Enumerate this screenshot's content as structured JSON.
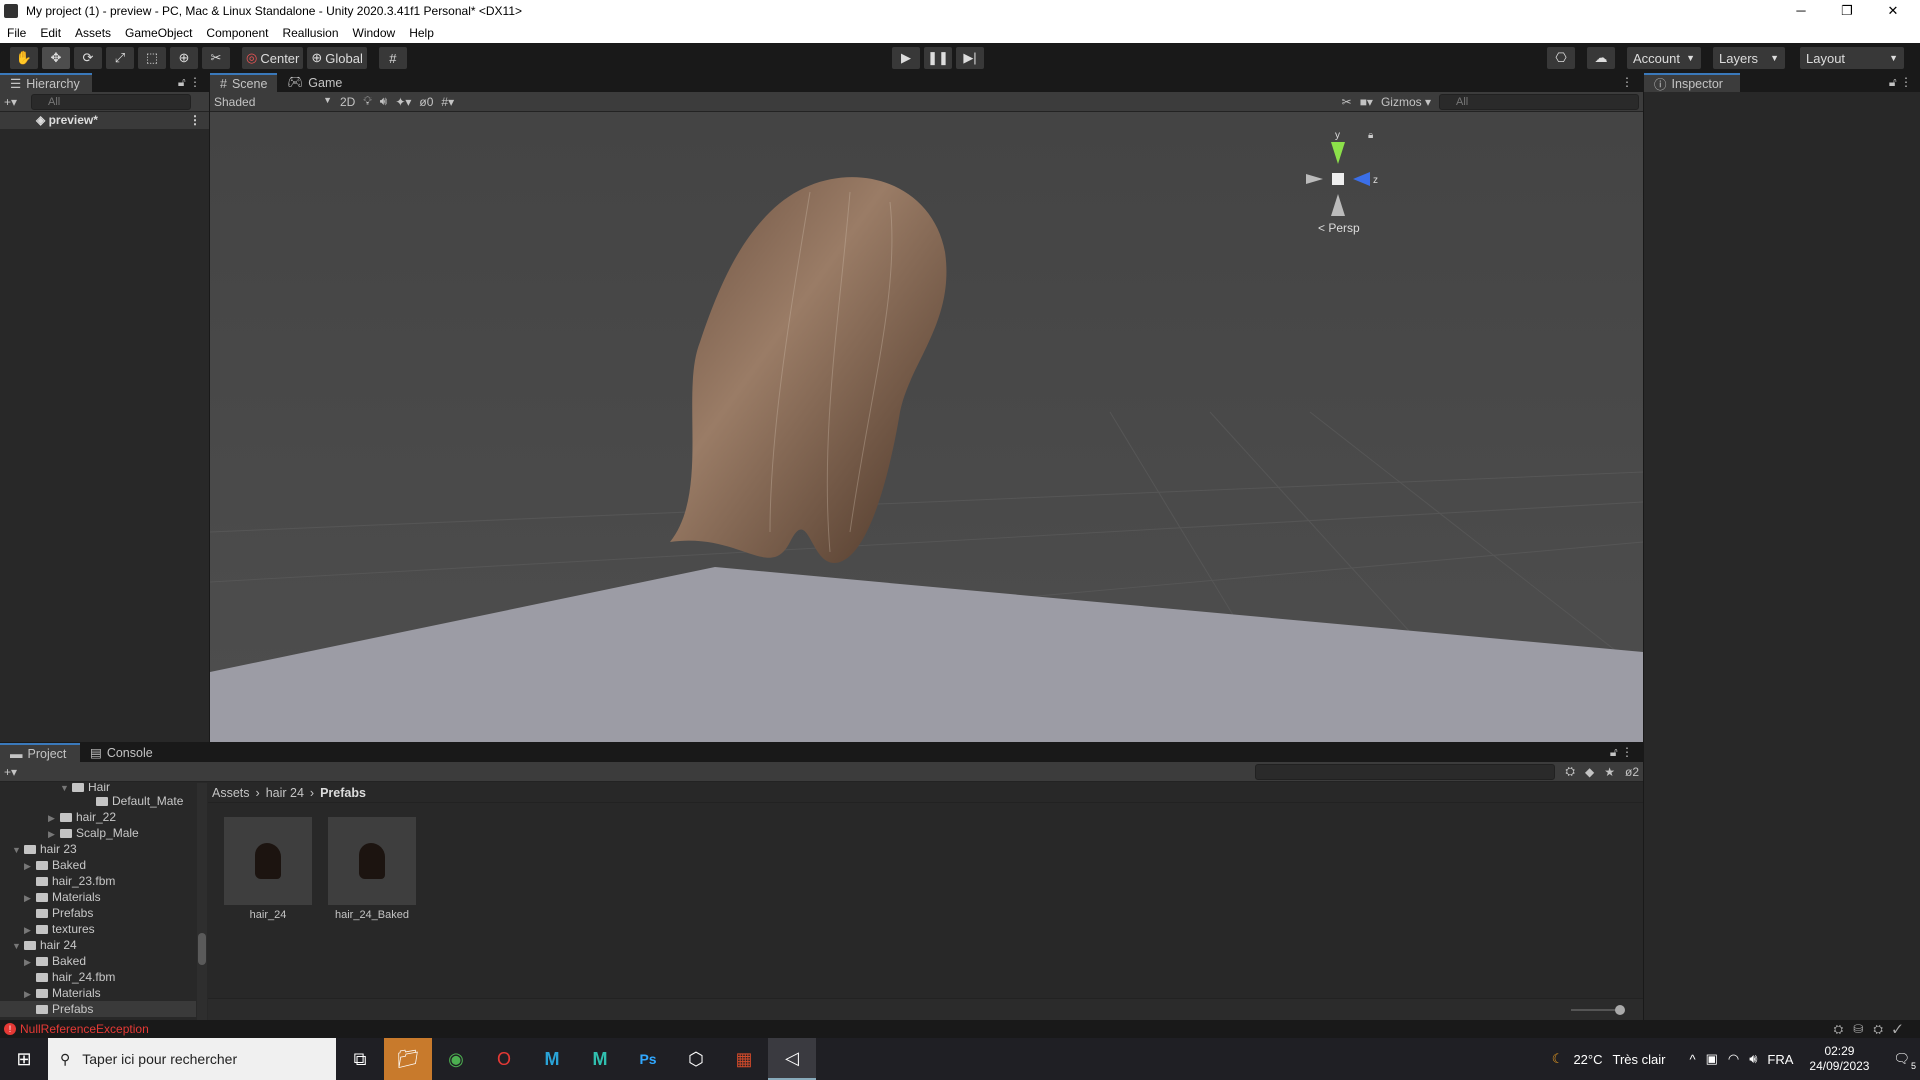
{
  "window": {
    "title": "My project (1) - preview - PC, Mac & Linux Standalone - Unity 2020.3.41f1 Personal* <DX11>",
    "min": "─",
    "max": "❐",
    "close": "✕"
  },
  "menu": [
    "File",
    "Edit",
    "Assets",
    "GameObject",
    "Component",
    "Reallusion",
    "Window",
    "Help"
  ],
  "toolbar": {
    "center": "Center",
    "global": "Global",
    "account": "Account",
    "layers": "Layers",
    "layout": "Layout"
  },
  "hierarchy": {
    "title": "Hierarchy",
    "search": "All",
    "scene": "preview*"
  },
  "scene": {
    "tab_scene": "Scene",
    "tab_game": "Game",
    "shading": "Shaded",
    "mode2d": "2D",
    "hidden_count": "0",
    "gizmos": "Gizmos",
    "search": "All",
    "persp": "Persp",
    "axis_y": "y",
    "axis_z": "z"
  },
  "inspector": {
    "title": "Inspector"
  },
  "project": {
    "tab_project": "Project",
    "tab_console": "Console",
    "hidden_count": "2",
    "breadcrumb": [
      "Assets",
      "hair 24",
      "Prefabs"
    ],
    "tree": [
      {
        "label": "Hair",
        "indent": 5,
        "arrow": "▼",
        "open": true
      },
      {
        "label": "Default_Mate",
        "indent": 7,
        "arrow": ""
      },
      {
        "label": "hair_22",
        "indent": 4,
        "arrow": "▶"
      },
      {
        "label": "Scalp_Male",
        "indent": 4,
        "arrow": "▶"
      },
      {
        "label": "hair 23",
        "indent": 1,
        "arrow": "▼",
        "open": true
      },
      {
        "label": "Baked",
        "indent": 2,
        "arrow": "▶"
      },
      {
        "label": "hair_23.fbm",
        "indent": 2,
        "arrow": ""
      },
      {
        "label": "Materials",
        "indent": 2,
        "arrow": "▶"
      },
      {
        "label": "Prefabs",
        "indent": 2,
        "arrow": ""
      },
      {
        "label": "textures",
        "indent": 2,
        "arrow": "▶"
      },
      {
        "label": "hair 24",
        "indent": 1,
        "arrow": "▼",
        "open": true
      },
      {
        "label": "Baked",
        "indent": 2,
        "arrow": "▶"
      },
      {
        "label": "hair_24.fbm",
        "indent": 2,
        "arrow": ""
      },
      {
        "label": "Materials",
        "indent": 2,
        "arrow": "▶"
      },
      {
        "label": "Prefabs",
        "indent": 2,
        "arrow": "",
        "selected": true
      }
    ],
    "assets": [
      "hair_24",
      "hair_24_Baked"
    ]
  },
  "status": {
    "error": "NullReferenceException",
    "error_color": "#e53935"
  },
  "taskbar": {
    "search": "Taper ici pour rechercher",
    "weather": "22°C",
    "weather_desc": "Très clair",
    "lang": "FRA",
    "time": "02:29",
    "date": "24/09/2023",
    "notifications": "5"
  }
}
